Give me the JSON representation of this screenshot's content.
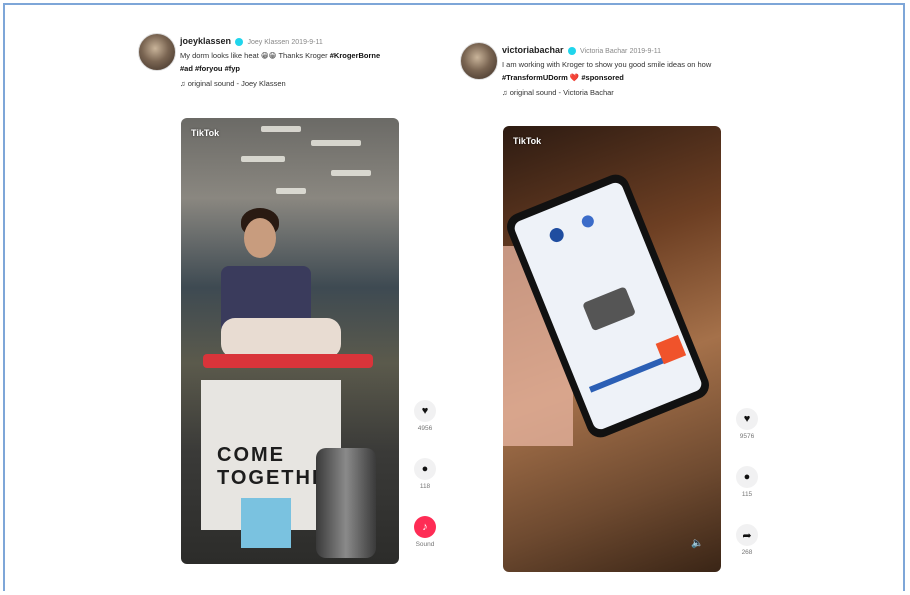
{
  "posts": [
    {
      "username": "joeyklassen",
      "display_name": "Joey Klassen",
      "timestamp": "2019-9-11",
      "caption": "My dorm looks like heat 😁😁 Thanks Kroger",
      "caption_tag": "#KrogerBorne",
      "hashtags": "#ad #foryou #fyp",
      "sound": "original sound - Joey Klassen",
      "video_text": "COME TOGETHER",
      "watermark": "TikTok",
      "actions": [
        {
          "icon": "heart-icon",
          "glyph": "♥",
          "count": "4956"
        },
        {
          "icon": "comment-icon",
          "glyph": "●",
          "count": "118"
        },
        {
          "icon": "music-disc-icon",
          "glyph": "♪",
          "count": "Sound"
        }
      ]
    },
    {
      "username": "victoriabachar",
      "display_name": "Victoria Bachar",
      "timestamp": "2019-9-11",
      "caption": "I am working with Kroger to show you good smile ideas on how",
      "hashtags": "#TransformUDorm ❤️ #sponsored",
      "sound": "original sound - Victoria Bachar",
      "watermark": "TikTok",
      "actions": [
        {
          "icon": "heart-icon",
          "glyph": "♥",
          "count": "9576"
        },
        {
          "icon": "comment-icon",
          "glyph": "●",
          "count": "115"
        },
        {
          "icon": "share-icon",
          "glyph": "➦",
          "count": "268"
        }
      ],
      "mute_glyph": "🔈"
    }
  ],
  "colors": {
    "frame_border": "#7ea6d8",
    "tiktok_red": "#fe2c55",
    "verified": "#20d5ec"
  }
}
